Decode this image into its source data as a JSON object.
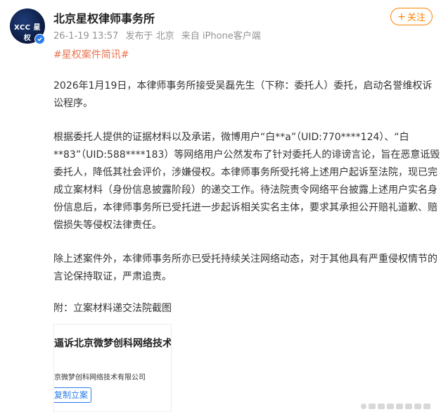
{
  "author": {
    "name": "北京星权律师事务所",
    "avatar_text": "XCC 星权",
    "verified_icon": "verified-badge-icon",
    "avatar_color": "#0b1a3f"
  },
  "meta": {
    "time": "26-1-19 13:57",
    "location": "发布于 北京",
    "source": "来自 iPhone客户端"
  },
  "follow_button": {
    "plus": "+",
    "label": "关注",
    "color": "#ff8200"
  },
  "hashtag": "#星权案件简讯#",
  "paragraphs": [
    "2026年1月19日，本律师事务所接受吴磊先生（下称：委托人）委托，启动名誉维权诉讼程序。",
    "根据委托人提供的证据材料以及承诺，微博用户“白**a”（UID:770****124）、“白**83”（UID:588****183）等网络用户公然发布了针对委托人的诽谤言论，旨在恶意诋毁委托人，降低其社会评价，涉嫌侵权。本律师事务所受托将上述用户起诉至法院，现已完成立案材料（身份信息披露阶段）的递交工作。待法院责令网络平台披露上述用户实名身份信息后，本律师事务所已受托进一步起诉相关实名主体，要求其承担公开赔礼道歉、赔偿损失等侵权法律责任。",
    "除上述案件外，本律师事务所亦已受托持续关注网络动态，对于其他具有严重侵权情节的言论保持取证，严肃追责。"
  ],
  "attachment_caption": "附：立案材料递交法院截图",
  "thumbnail": {
    "heading": "逼诉北京微梦创科网络技术有",
    "subtext": "京微梦创科网络技术有限公司",
    "button": "复制立案"
  },
  "watermark_icon": "watermark-logo-icon"
}
